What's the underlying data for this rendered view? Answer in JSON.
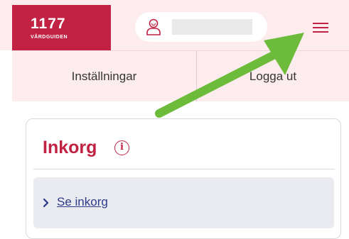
{
  "header": {
    "logo_number": "1177",
    "logo_subtitle": "VÅRDGUIDEN",
    "brand_color": "#c12143",
    "background_color": "#fcecee",
    "profile_icon": "user-avatar-icon",
    "menu_icon": "hamburger-menu-icon"
  },
  "submenu": {
    "settings_label": "Inställningar",
    "logout_label": "Logga ut"
  },
  "inbox_card": {
    "title": "Inkorg",
    "info_icon_glyph": "i",
    "link_label": "Se inkorg",
    "link_color": "#2b3a8a"
  },
  "annotation": {
    "arrow_color": "#6dbb3a",
    "points_to": "hamburger-menu-icon"
  }
}
